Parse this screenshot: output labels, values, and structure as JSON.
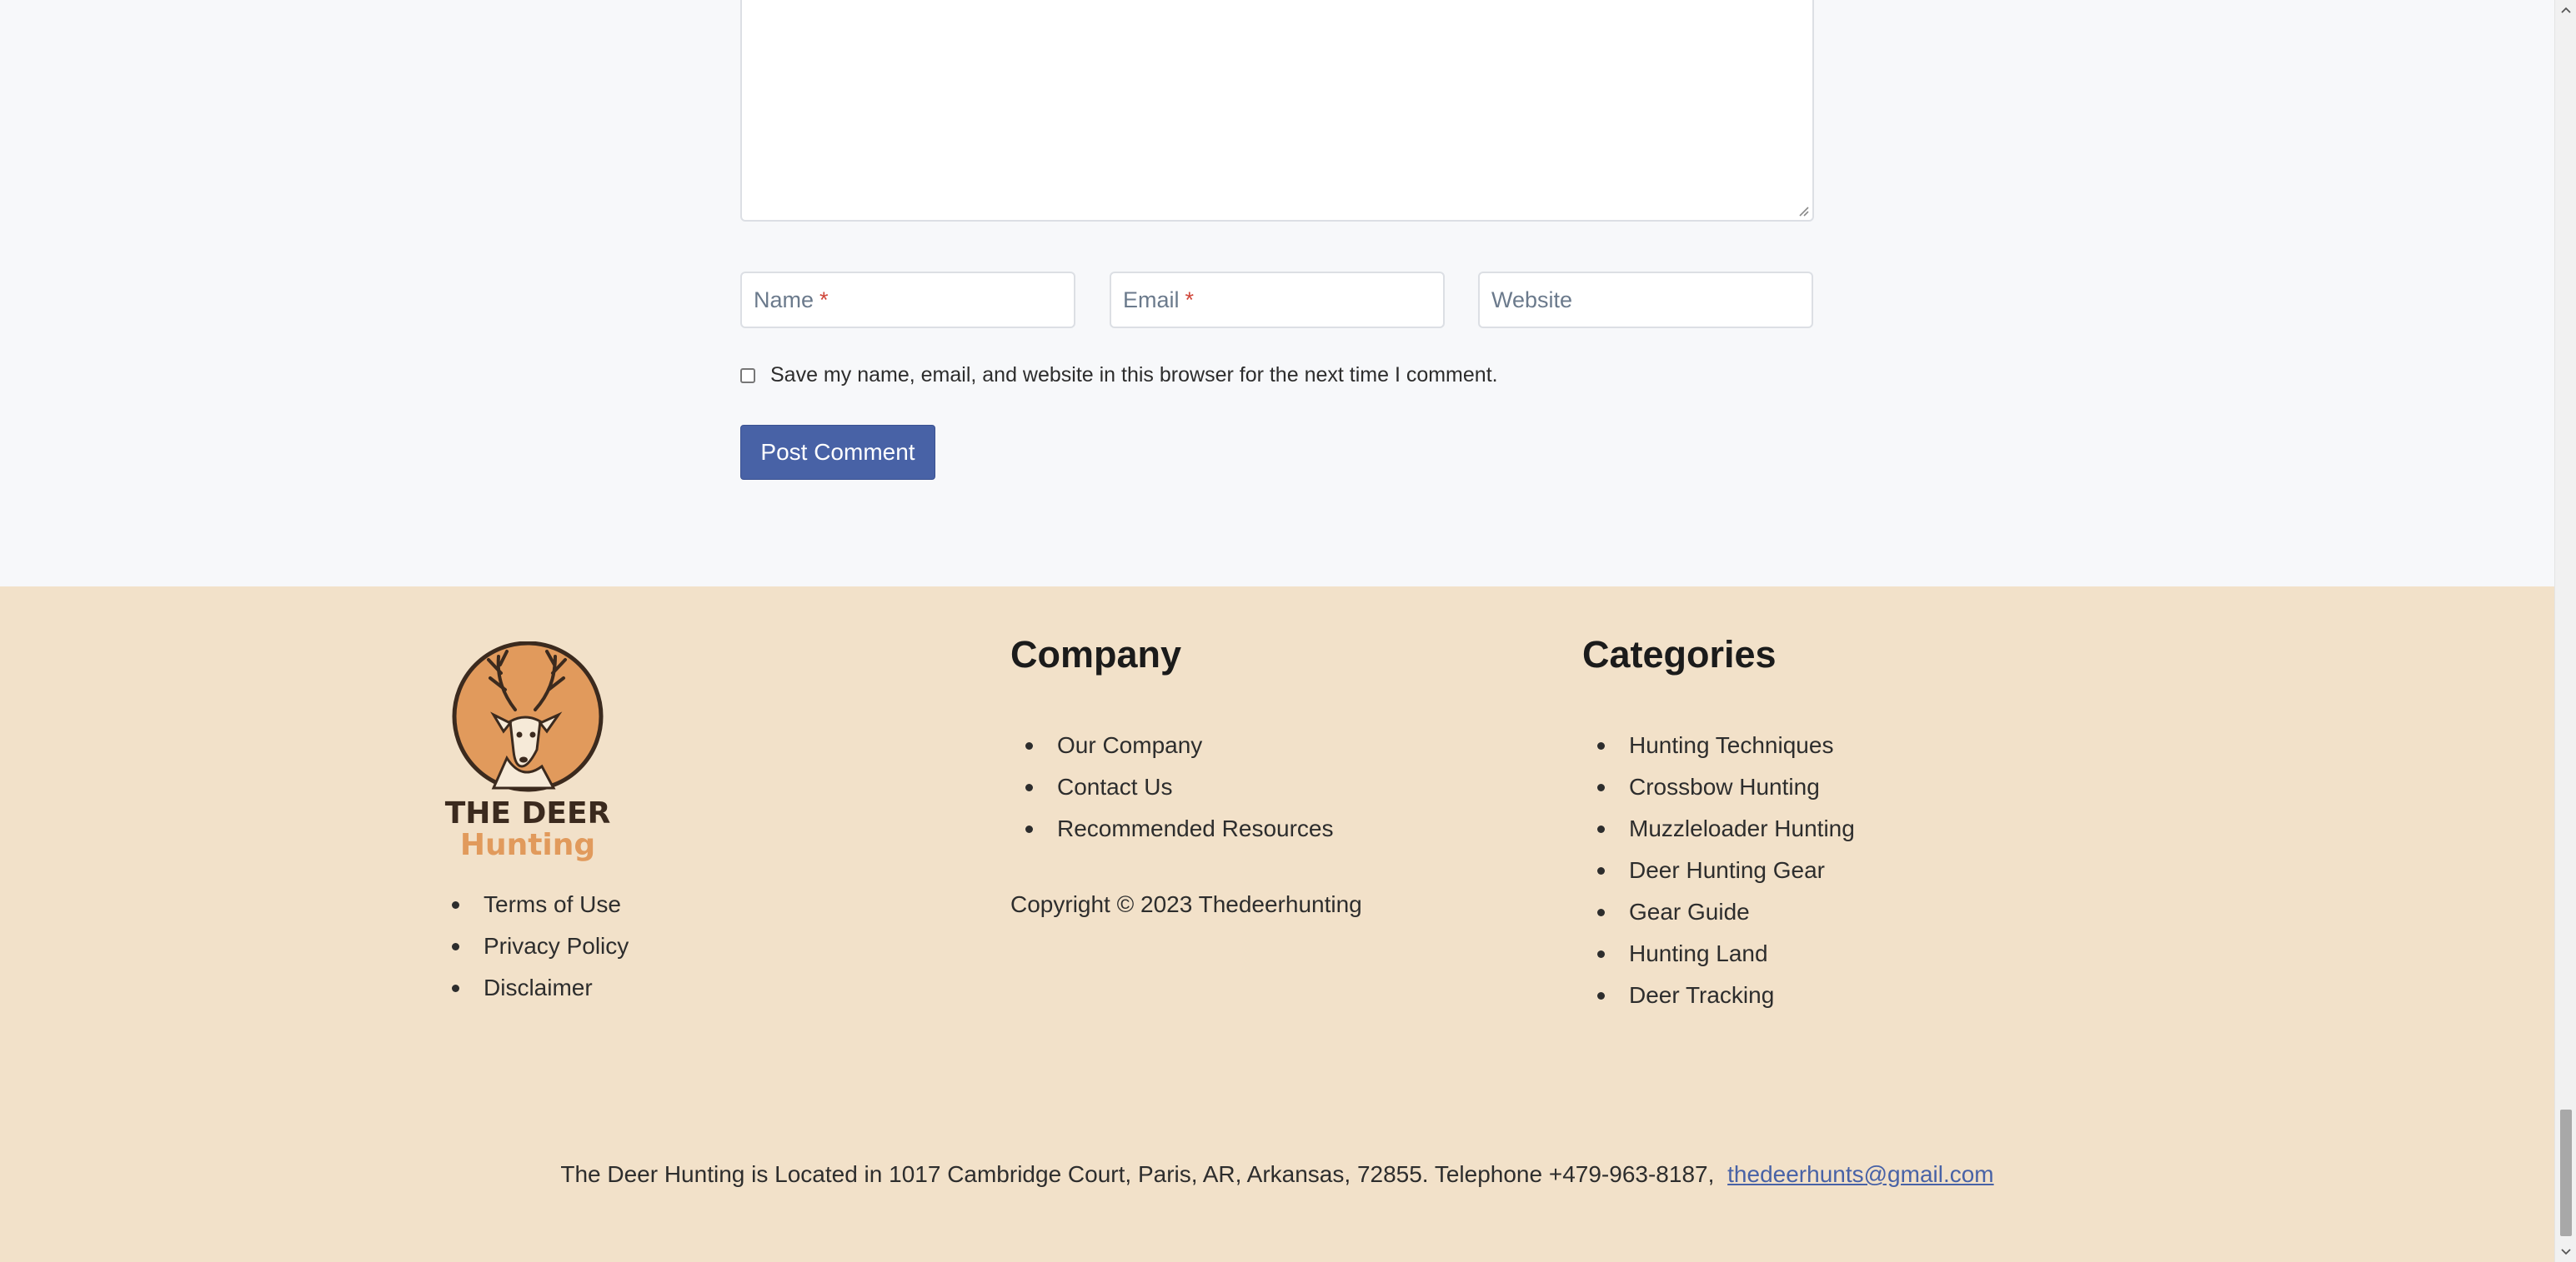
{
  "comment_form": {
    "name_placeholder": "Name",
    "email_placeholder": "Email",
    "website_placeholder": "Website",
    "required_marker": "*",
    "consent_label": "Save my name, email, and website in this browser for the next time I comment.",
    "consent_checked": false,
    "submit_label": "Post Comment"
  },
  "footer": {
    "logo": {
      "line1": "THE DEER",
      "line2": "Hunting"
    },
    "legal_links": [
      "Terms of Use",
      "Privacy Policy",
      "Disclaimer"
    ],
    "company": {
      "heading": "Company",
      "links": [
        "Our Company",
        "Contact Us",
        "Recommended Resources"
      ],
      "copyright": "Copyright © 2023 Thedeerhunting"
    },
    "categories": {
      "heading": "Categories",
      "links": [
        "Hunting Techniques",
        "Crossbow Hunting",
        "Muzzleloader Hunting",
        "Deer Hunting Gear",
        "Gear Guide",
        "Hunting Land",
        "Deer Tracking"
      ]
    },
    "address_text": "The Deer Hunting is Located in 1017 Cambridge Court, Paris, AR, Arkansas, 72855. Telephone +479-963-8187,",
    "email_link": "thedeerhunts@gmail.com"
  },
  "colors": {
    "page_bg": "#f7f8fa",
    "footer_bg": "#f2e1c9",
    "accent": "#4862a6",
    "logo_orange": "#e19a5c",
    "logo_dark": "#3b2a1e",
    "required": "#d0463a"
  },
  "icons": {
    "logo": "deer-head-logo",
    "resize": "resize-grip-icon",
    "scroll_up": "chevron-up-icon",
    "scroll_down": "chevron-down-icon"
  }
}
